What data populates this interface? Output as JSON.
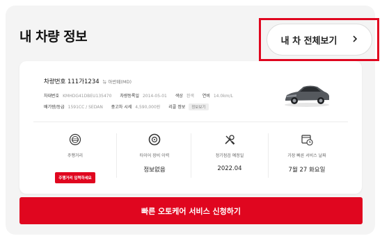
{
  "header": {
    "title": "내 차량 정보",
    "view_all_label": "내 차 전체보기",
    "view_all_icon": "chevron-right-icon"
  },
  "vehicle": {
    "plate_label": "차량번호",
    "plate_number": "111가1234",
    "model": "뉴 아반떼(MD)",
    "specs_row1": [
      {
        "label": "차대번호",
        "value": "KMHDG41DBEU135470"
      },
      {
        "label": "차량등록일",
        "value": "2014-05-01"
      },
      {
        "label": "색상",
        "value": "흰색"
      },
      {
        "label": "연비",
        "value": "14.0km/L"
      }
    ],
    "specs_row2": [
      {
        "label": "배기량/등급",
        "value": "1591CC / SEDAN"
      },
      {
        "label": "중고차 시세",
        "value": "4,590,000원"
      },
      {
        "label": "리콜 정보",
        "tag": "정보보기"
      }
    ]
  },
  "stats": [
    {
      "icon": "odometer-icon",
      "label": "주행거리",
      "button": "주행거리 입력하세요"
    },
    {
      "icon": "tire-icon",
      "label": "타이어 장비 이력",
      "value": "정보없음"
    },
    {
      "icon": "wrench-screwdriver-icon",
      "label": "정기점검 예정일",
      "value": "2022.04"
    },
    {
      "icon": "calendar-clock-icon",
      "label": "가장 빠른 서비스 날짜",
      "value": "7월 27 화요일"
    }
  ],
  "cta": {
    "label": "빠른 오토케어 서비스 신청하기"
  },
  "colors": {
    "accent": "#e0061f",
    "panel_bg": "#f4f4f4"
  }
}
